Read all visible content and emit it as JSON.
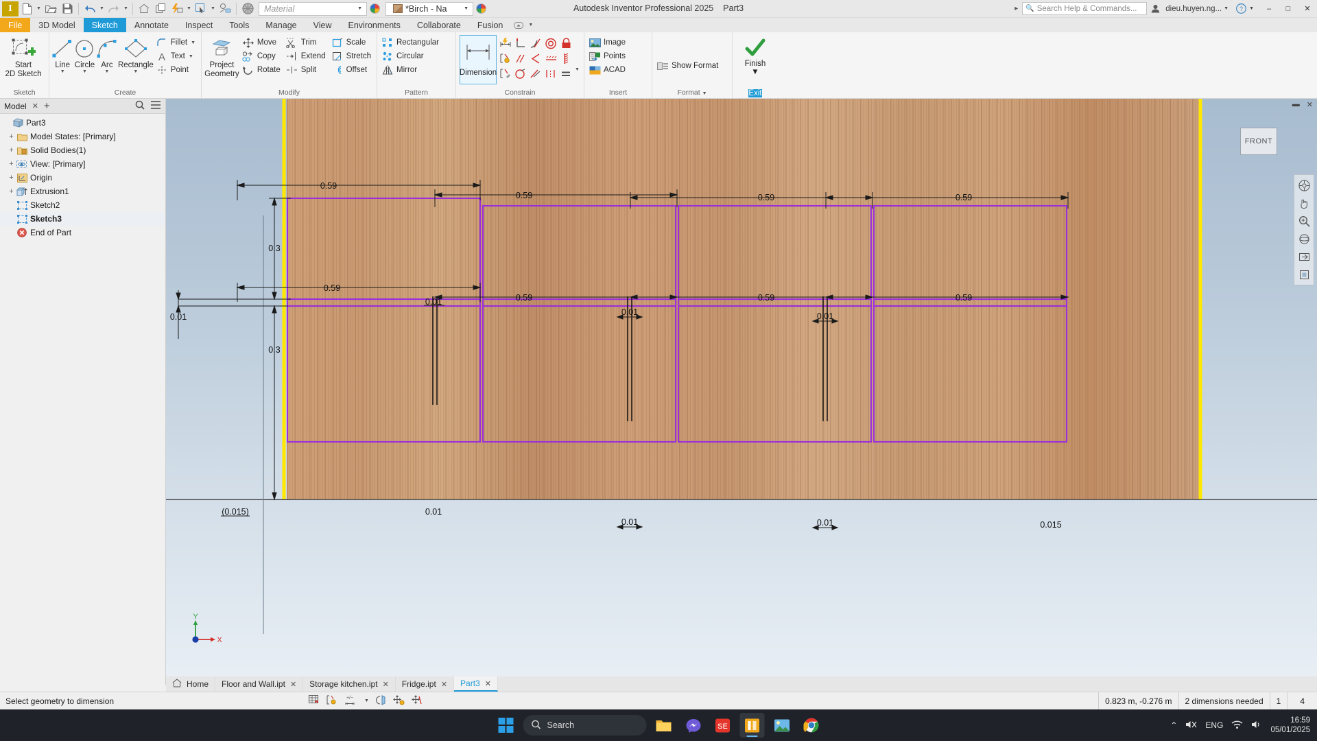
{
  "titlebar": {
    "app_title": "Autodesk Inventor Professional 2025",
    "document_title": "Part3",
    "material_placeholder": "Material",
    "appearance_value": "*Birch - Na",
    "search_placeholder": "Search Help & Commands...",
    "user_name": "dieu.huyen.ng...",
    "help_icon": "help-icon",
    "minimize": "–",
    "maximize": "□",
    "close": "✕"
  },
  "ribbon_tabs": [
    {
      "label": "File",
      "state": "file"
    },
    {
      "label": "3D Model",
      "state": "normal"
    },
    {
      "label": "Sketch",
      "state": "active"
    },
    {
      "label": "Annotate",
      "state": "normal"
    },
    {
      "label": "Inspect",
      "state": "normal"
    },
    {
      "label": "Tools",
      "state": "normal"
    },
    {
      "label": "Manage",
      "state": "normal"
    },
    {
      "label": "View",
      "state": "normal"
    },
    {
      "label": "Environments",
      "state": "normal"
    },
    {
      "label": "Collaborate",
      "state": "normal"
    },
    {
      "label": "Fusion",
      "state": "normal"
    }
  ],
  "ribbon": {
    "panels": [
      {
        "name": "Sketch",
        "label": "Sketch"
      },
      {
        "name": "Create",
        "label": "Create"
      },
      {
        "name": "Modify",
        "label": "Modify"
      },
      {
        "name": "Pattern",
        "label": "Pattern"
      },
      {
        "name": "Constrain",
        "label": "Constrain"
      },
      {
        "name": "Insert",
        "label": "Insert"
      },
      {
        "name": "Format",
        "label": "Format"
      },
      {
        "name": "Exit",
        "label": ""
      }
    ],
    "sketch": {
      "start_2d_sketch_line1": "Start",
      "start_2d_sketch_line2": "2D Sketch"
    },
    "create": {
      "line": "Line",
      "circle": "Circle",
      "arc": "Arc",
      "rectangle": "Rectangle",
      "fillet": "Fillet",
      "text": "Text",
      "point": "Point"
    },
    "modify": {
      "project_geometry_line1": "Project",
      "project_geometry_line2": "Geometry",
      "move": "Move",
      "copy": "Copy",
      "rotate": "Rotate",
      "trim": "Trim",
      "extend": "Extend",
      "split": "Split",
      "scale": "Scale",
      "stretch": "Stretch",
      "offset": "Offset"
    },
    "pattern": {
      "rectangular": "Rectangular",
      "circular": "Circular",
      "mirror": "Mirror"
    },
    "constrain": {
      "dimension": "Dimension",
      "icons": [
        "auto-dimension-icon",
        "perpendicular-icon",
        "tangent-icon",
        "concentric-icon",
        "fix-icon",
        "show-constraints-icon",
        "parallel-icon",
        "coincident-icon",
        "horizontal-icon",
        "vertical-icon",
        "constraint-settings-icon",
        "collinear-icon",
        "smooth-icon",
        "symmetric-icon",
        "equal-icon"
      ]
    },
    "insert": {
      "image": "Image",
      "points": "Points",
      "acad": "ACAD"
    },
    "format": {
      "show_format": "Show Format"
    },
    "exit": {
      "finish": "Finish",
      "exit_label": "Exit"
    }
  },
  "browser": {
    "tab_label": "Model",
    "close_icon": "close-icon",
    "add_icon": "plus-icon",
    "search_icon": "search-icon",
    "menu_icon": "hamburger-icon",
    "tree": [
      {
        "label": "Part3",
        "depth": 0,
        "expander": "",
        "icon": "part-icon",
        "selected": false
      },
      {
        "label": "Model States: [Primary]",
        "depth": 1,
        "expander": "+",
        "icon": "folder-icon",
        "selected": false
      },
      {
        "label": "Solid Bodies(1)",
        "depth": 1,
        "expander": "+",
        "icon": "folder-solid-icon",
        "selected": false
      },
      {
        "label": "View: [Primary]",
        "depth": 1,
        "expander": "+",
        "icon": "eye-icon",
        "selected": false
      },
      {
        "label": "Origin",
        "depth": 1,
        "expander": "+",
        "icon": "origin-icon",
        "selected": false
      },
      {
        "label": "Extrusion1",
        "depth": 1,
        "expander": "+",
        "icon": "extrusion-icon",
        "selected": false
      },
      {
        "label": "Sketch2",
        "depth": 1,
        "expander": "",
        "icon": "sketch-icon",
        "selected": false
      },
      {
        "label": "Sketch3",
        "depth": 1,
        "expander": "",
        "icon": "sketch-icon",
        "selected": true
      },
      {
        "label": "End of Part",
        "depth": 1,
        "expander": "",
        "icon": "end-of-part-icon",
        "selected": false
      }
    ]
  },
  "viewport": {
    "viewcube_label": "FRONT",
    "nav_icons": [
      "full-navigation-wheel-icon",
      "pan-icon",
      "zoom-icon",
      "orbit-icon",
      "look-at-icon",
      "view-face-icon"
    ],
    "minimize_icon": "minimize-icon",
    "close_icon": "close-icon",
    "triad": {
      "x_label": "X",
      "y_label": "Y"
    },
    "dimensions": {
      "top_row": [
        "0.59",
        "0.59",
        "0.59",
        "0.59"
      ],
      "mid_row": [
        "0.59",
        "0.59",
        "0.59",
        "0.59"
      ],
      "vertical_upper": "0.3",
      "vertical_lower": "0.3",
      "thickness_left": "0.01",
      "gap_labels": [
        "0.01",
        "0.01",
        "0.01",
        "0.01"
      ],
      "bottom_left_ref": "(0.015)",
      "bottom_gaps": [
        "0.01",
        "0.01",
        "0.01"
      ],
      "bottom_right": "0.015"
    }
  },
  "doc_tabs": [
    {
      "label": "Home",
      "icon": "home-icon",
      "closable": false,
      "active": false
    },
    {
      "label": "Floor and Wall.ipt",
      "icon": "",
      "closable": true,
      "active": false
    },
    {
      "label": "Storage kitchen.ipt",
      "icon": "",
      "closable": true,
      "active": false
    },
    {
      "label": "Fridge.ipt",
      "icon": "",
      "closable": true,
      "active": false
    },
    {
      "label": "Part3",
      "icon": "",
      "closable": true,
      "active": true
    }
  ],
  "statusbar": {
    "message": "Select geometry to dimension",
    "icons": [
      "grid-snap-icon",
      "show-constraints-status-icon",
      "dimension-display-icon",
      "slice-graphics-icon",
      "auto-project-icon",
      "auto-project-part-origin-icon"
    ],
    "coordinates": "0.823 m, -0.276 m",
    "dimensions_needed": "2 dimensions needed",
    "count_1": "1",
    "count_2": "4"
  },
  "taskbar": {
    "search_placeholder": "Search",
    "search_icon": "search-icon",
    "apps": [
      {
        "name": "file-explorer-icon",
        "active": false
      },
      {
        "name": "messenger-icon",
        "active": false
      },
      {
        "name": "sketchup-icon",
        "active": false
      },
      {
        "name": "inventor-icon",
        "active": true
      },
      {
        "name": "photos-icon",
        "active": false
      },
      {
        "name": "chrome-icon",
        "active": false
      }
    ],
    "tray": {
      "chevron_icon": "chevron-up-icon",
      "mute_icon": "mute-icon",
      "language": "ENG",
      "wifi_icon": "wifi-icon",
      "volume_icon": "volume-icon",
      "time": "16:59",
      "date": "05/01/2025"
    }
  }
}
